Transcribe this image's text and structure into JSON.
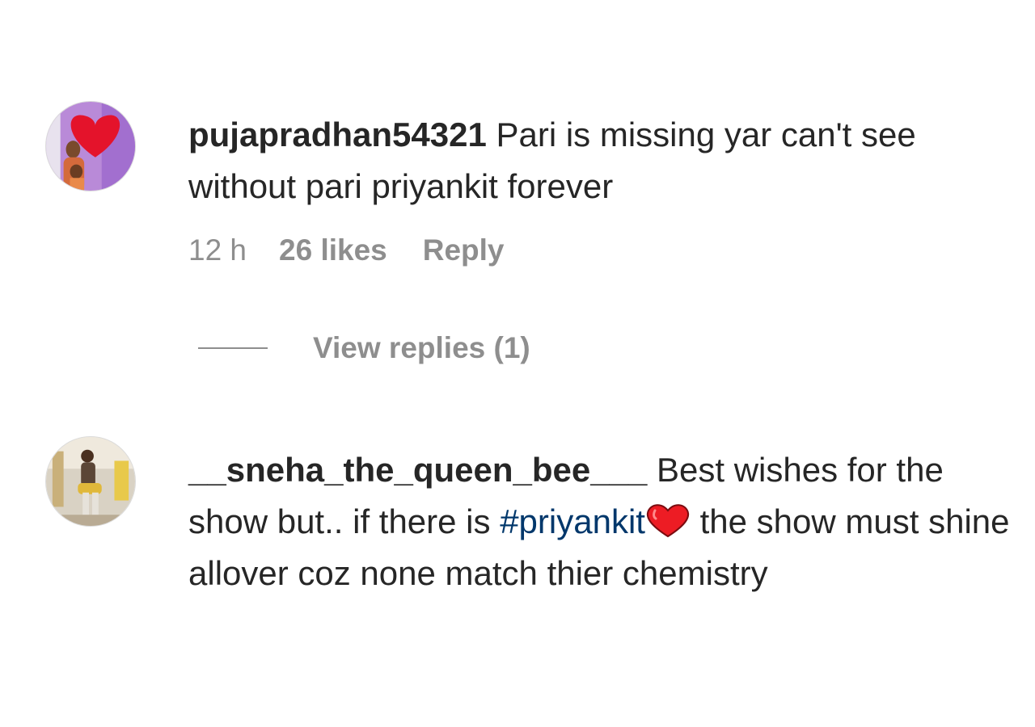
{
  "comments": [
    {
      "username": "pujapradhan54321",
      "text": "Pari is missing yar can't see without pari priyankit forever",
      "time": "12 h",
      "likes": "26 likes",
      "reply_label": "Reply",
      "view_replies_label": "View replies (1)"
    },
    {
      "username": "__sneha_the_queen_bee___",
      "text_before": "Best wishes for the show but.. if there is",
      "hashtag": "#priyankit",
      "emoji": "red-heart-emoji",
      "text_after": "the show must shine allover coz none match thier chemistry"
    }
  ],
  "colors": {
    "username": "#262626",
    "text": "#262626",
    "meta": "#8e8e8e",
    "hashtag": "#00376b",
    "heart": "#ed1c24"
  }
}
